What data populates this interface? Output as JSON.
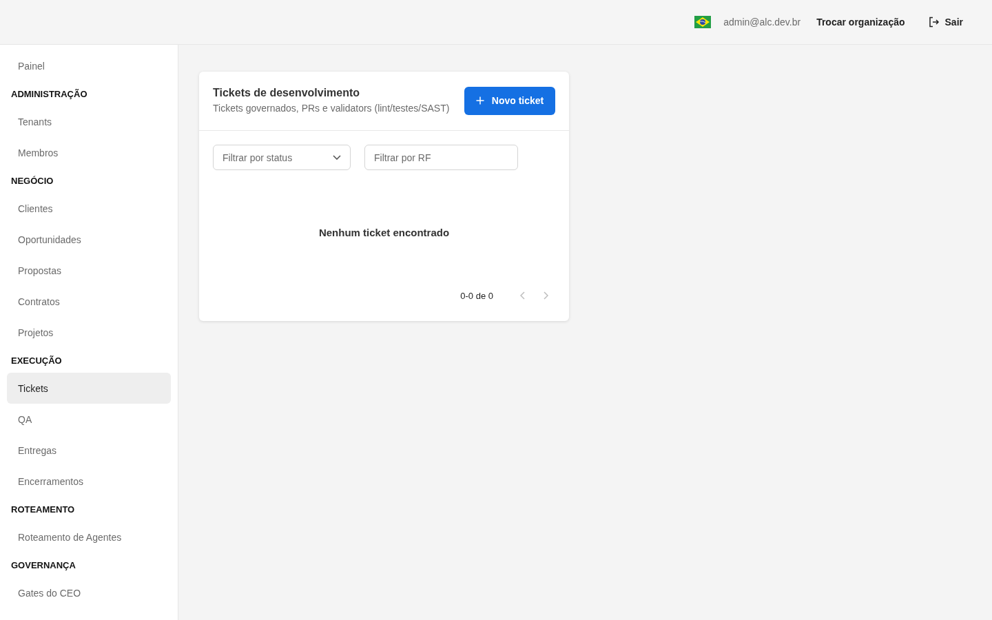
{
  "header": {
    "user_email": "admin@alc.dev.br",
    "switch_org_button": "Trocar organização",
    "logout_button": "Sair"
  },
  "sidebar": {
    "groups": [
      {
        "items": [
          {
            "label": "Painel",
            "selected": false
          }
        ]
      },
      {
        "title": "ADMINISTRAÇÃO",
        "items": [
          {
            "label": "Tenants",
            "selected": false
          },
          {
            "label": "Membros",
            "selected": false
          }
        ]
      },
      {
        "title": "NEGÓCIO",
        "items": [
          {
            "label": "Clientes",
            "selected": false
          },
          {
            "label": "Oportunidades",
            "selected": false
          },
          {
            "label": "Propostas",
            "selected": false
          },
          {
            "label": "Contratos",
            "selected": false
          },
          {
            "label": "Projetos",
            "selected": false
          }
        ]
      },
      {
        "title": "EXECUÇÃO",
        "items": [
          {
            "label": "Tickets",
            "selected": true
          },
          {
            "label": "QA",
            "selected": false
          },
          {
            "label": "Entregas",
            "selected": false
          },
          {
            "label": "Encerramentos",
            "selected": false
          }
        ]
      },
      {
        "title": "ROTEAMENTO",
        "items": [
          {
            "label": "Roteamento de Agentes",
            "selected": false
          }
        ]
      },
      {
        "title": "GOVERNANÇA",
        "items": [
          {
            "label": "Gates do CEO",
            "selected": false
          }
        ]
      }
    ]
  },
  "card": {
    "title": "Tickets de desenvolvimento",
    "subtitle": "Tickets governados, PRs e validators (lint/testes/SAST)",
    "new_button": "Novo ticket",
    "status_filter": {
      "placeholder": "Filtrar por status"
    },
    "rf_filter": {
      "placeholder": "Filtrar por RF"
    },
    "empty_message": "Nenhum ticket encontrado",
    "pagination": {
      "range": "0-0 de 0",
      "prev_disabled": true,
      "next_disabled": true
    }
  }
}
